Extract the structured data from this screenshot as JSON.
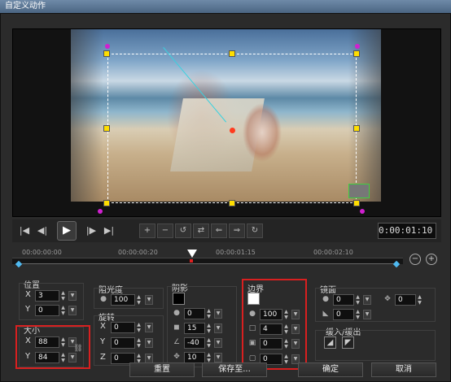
{
  "window": {
    "title": "自定义动作"
  },
  "playback": {
    "timecode": "0:00:01:10"
  },
  "timeline": {
    "ticks": [
      "00:00:00:00",
      "00:00:00:20",
      "00:00:01:15",
      "00:00:02:10"
    ]
  },
  "position": {
    "label": "位置",
    "x_label": "X",
    "x": "3",
    "y_label": "Y",
    "y": "0"
  },
  "size": {
    "label": "大小",
    "x_label": "X",
    "x": "88",
    "y_label": "Y",
    "y": "84"
  },
  "opacity": {
    "label": "阻光度",
    "value": "100"
  },
  "rotation": {
    "label": "旋转",
    "x_label": "X",
    "x": "0",
    "y_label": "Y",
    "y": "0",
    "z_label": "Z",
    "z": "0"
  },
  "shadow": {
    "label": "阴影",
    "color": "#000000",
    "opacity": "0",
    "blur": "15",
    "angle": "-40",
    "distance": "10"
  },
  "border": {
    "label": "边界",
    "color": "#ffffff",
    "opacity": "100",
    "width": "4",
    "v2": "0",
    "v3": "0"
  },
  "mirror": {
    "label": "镜面",
    "v1": "0",
    "v2": "0",
    "v3": "0"
  },
  "fade": {
    "label": "缓入/缓出"
  },
  "buttons": {
    "reset": "重置",
    "save_to": "保存至...",
    "ok": "确定",
    "cancel": "取消"
  },
  "accent": {
    "highlight_red": "#d82020",
    "handle_yellow": "#ffde00",
    "keyframe_blue": "#4fb9f0"
  }
}
